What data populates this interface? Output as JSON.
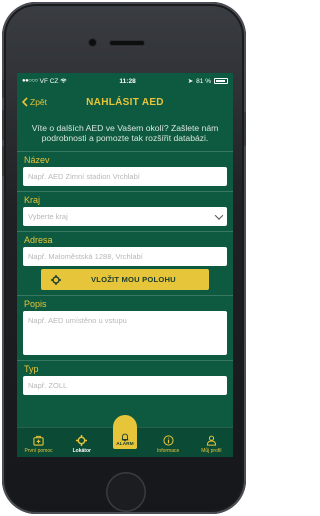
{
  "statusbar": {
    "carrier": "VF CZ",
    "time": "11:28",
    "battery": "81 %"
  },
  "navbar": {
    "back_label": "Zpět",
    "title": "NAHLÁSIT AED"
  },
  "intro": "Víte o dalších AED ve Vašem okolí? Zašlete nám podrobnosti a pomozte tak rozšířit databázi.",
  "form": {
    "name": {
      "label": "Název",
      "placeholder": "Např. AED Zimní stadion Vrchlabí"
    },
    "region": {
      "label": "Kraj",
      "placeholder": "Vyberte kraj"
    },
    "address": {
      "label": "Adresa",
      "placeholder": "Např. Maloměstská 1288, Vrchlabí"
    },
    "locate_button": "VLOŽIT MOU POLOHU",
    "description": {
      "label": "Popis",
      "placeholder": "Např. AED umístěno u vstupu"
    },
    "type": {
      "label": "Typ",
      "placeholder": "Např. ZOLL"
    }
  },
  "tabs": [
    {
      "label": "První pomoc",
      "icon": "first-aid-icon"
    },
    {
      "label": "Lokátor",
      "icon": "locator-icon"
    },
    {
      "label": "ALARM",
      "icon": "bell-icon"
    },
    {
      "label": "Informace",
      "icon": "info-icon"
    },
    {
      "label": "Můj profil",
      "icon": "profile-icon"
    }
  ],
  "colors": {
    "background": "#0e5a40",
    "accent": "#e6c53a"
  }
}
